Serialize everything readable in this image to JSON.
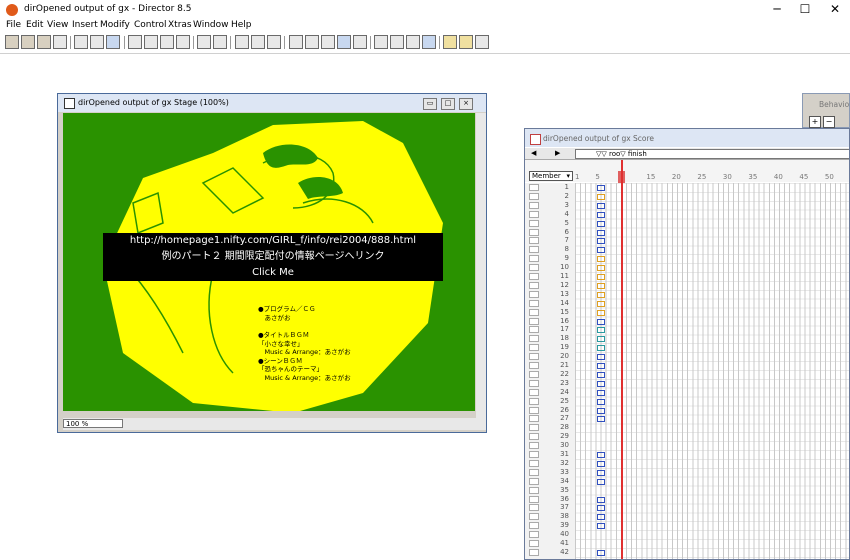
{
  "app": {
    "title": "dirOpened output of gx - Director 8.5",
    "window_controls": {
      "minimize": "─",
      "maximize": "☐",
      "close": "✕"
    }
  },
  "menu": [
    "File",
    "Edit",
    "View",
    "Insert",
    "Modify",
    "Control",
    "Xtras",
    "Window",
    "Help"
  ],
  "stage": {
    "title": "dirOpened output of gx Stage (100%)",
    "zoom": "100 %",
    "background_color": "#2a9200",
    "shape_color": "#ffff00",
    "link_overlay": {
      "url": "http://homepage1.nifty.com/GIRL_f/info/rei2004/888.html",
      "line2": "例のパート２ 期間限定配付の情報ページへリンク",
      "line3": "Click Me"
    },
    "credits": [
      "●プログラム／ＣＧ",
      "　あさがお",
      "●タイトルＢＧＭ",
      "「小さな幸せ」",
      "　Music & Arrange：あさがお",
      "●シーンＢＧＭ",
      "「恐ちゃんのテーマ」",
      "　Music & Arrange：あさがお"
    ]
  },
  "score": {
    "title": "dirOpened output of gx Score",
    "markers": "▽▽ roo▽ finish",
    "member_label": "Member",
    "frame_labels": [
      "1",
      "5",
      "15",
      "20",
      "25",
      "30",
      "35",
      "40",
      "45",
      "50"
    ],
    "channels": [
      "1",
      "2",
      "3",
      "4",
      "5",
      "6",
      "7",
      "8",
      "9",
      "10",
      "11",
      "12",
      "13",
      "14",
      "15",
      "16",
      "17",
      "18",
      "19",
      "20",
      "21",
      "22",
      "23",
      "24",
      "25",
      "26",
      "27",
      "28",
      "29",
      "30",
      "31",
      "32",
      "33",
      "34",
      "35",
      "36",
      "37",
      "38",
      "39",
      "40",
      "41",
      "42"
    ],
    "playhead_frame": 10,
    "playhead_color": "#e03030"
  },
  "behavior": {
    "title": "Behavior",
    "add_label": "+",
    "remove_label": "−"
  }
}
